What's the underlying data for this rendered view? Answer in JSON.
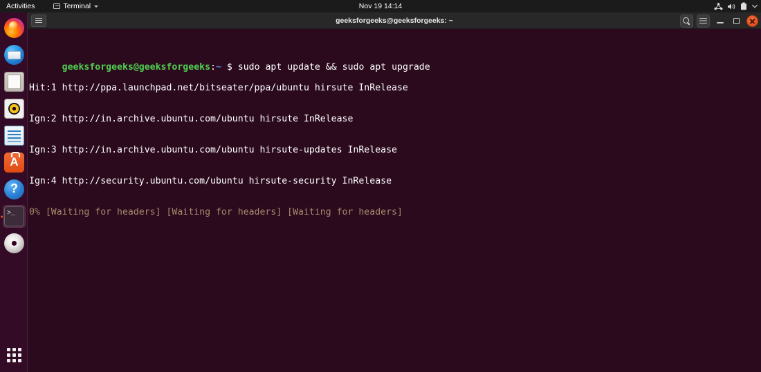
{
  "topbar": {
    "activities_label": "Activities",
    "app_menu_label": "Terminal",
    "app_menu_icon": "window-icon",
    "app_menu_chevron_icon": "chevron-down-icon",
    "clock": "Nov 19  14:14",
    "status_icons": [
      "network-icon",
      "volume-icon",
      "battery-icon",
      "chevron-down-icon"
    ]
  },
  "dock": {
    "items": [
      {
        "name": "firefox",
        "label": "Firefox Web Browser",
        "running": false
      },
      {
        "name": "thunderbird",
        "label": "Thunderbird Mail",
        "running": false
      },
      {
        "name": "files",
        "label": "Files",
        "running": false
      },
      {
        "name": "rhythmbox",
        "label": "Rhythmbox",
        "running": false
      },
      {
        "name": "libreoffice-writer",
        "label": "LibreOffice Writer",
        "running": false
      },
      {
        "name": "ubuntu-software",
        "label": "Ubuntu Software",
        "running": false
      },
      {
        "name": "help",
        "label": "Help",
        "running": false
      },
      {
        "name": "terminal",
        "label": "Terminal",
        "running": true
      },
      {
        "name": "disc",
        "label": "Disc Image Mounter",
        "running": false
      }
    ],
    "show_apps_label": "Show Applications"
  },
  "window": {
    "title": "geeksforgeeks@geeksforgeeks: ~",
    "tab_menu_icon": "menu-icon",
    "controls": {
      "search_icon": "search-icon",
      "menu_icon": "hamburger-menu-icon",
      "minimize_icon": "minimize-icon",
      "maximize_icon": "maximize-icon",
      "close_icon": "close-icon"
    }
  },
  "terminal": {
    "prompt": {
      "user_host": "geeksforgeeks@geeksforgeeks",
      "colon": ":",
      "path": "~",
      "symbol": "$"
    },
    "command": "sudo apt update && sudo apt upgrade",
    "output": [
      "Hit:1 http://ppa.launchpad.net/bitseater/ppa/ubuntu hirsute InRelease",
      "Ign:2 http://in.archive.ubuntu.com/ubuntu hirsute InRelease",
      "Ign:3 http://in.archive.ubuntu.com/ubuntu hirsute-updates InRelease",
      "Ign:4 http://security.ubuntu.com/ubuntu hirsute-security InRelease"
    ],
    "status_line": "0% [Waiting for headers] [Waiting for headers] [Waiting for headers]"
  },
  "colors": {
    "terminal_background": "#2b0a1e",
    "titlebar": "#282828",
    "topbar": "#1b1b1b",
    "prompt_user": "#4fd14f",
    "prompt_path": "#5c7fe0",
    "status_text": "#a8896b",
    "accent_orange": "#e95420"
  }
}
